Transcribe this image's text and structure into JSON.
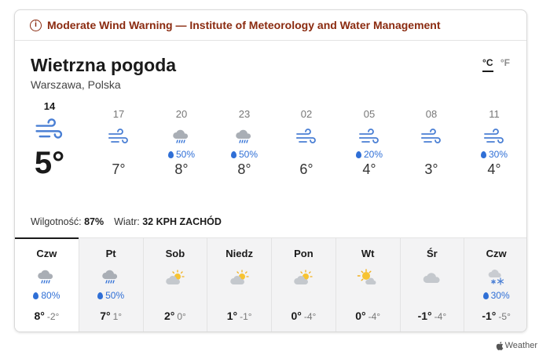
{
  "alert": {
    "icon": "info-circle-icon",
    "symbol": "i",
    "text": "Moderate Wind Warning — Institute of Meteorology and Water Management"
  },
  "header": {
    "title": "Wietrzna pogoda",
    "location": "Warszawa, Polska",
    "unit_c": "°C",
    "unit_f": "°F",
    "selected_unit": "C"
  },
  "hourly": [
    {
      "time": "14",
      "icon": "wind-icon",
      "precip": "",
      "temp": "5°",
      "current": true
    },
    {
      "time": "17",
      "icon": "wind-icon",
      "precip": "",
      "temp": "7°"
    },
    {
      "time": "20",
      "icon": "rain-icon",
      "precip": "50%",
      "temp": "8°"
    },
    {
      "time": "23",
      "icon": "rain-icon",
      "precip": "50%",
      "temp": "8°"
    },
    {
      "time": "02",
      "icon": "wind-icon",
      "precip": "",
      "temp": "6°"
    },
    {
      "time": "05",
      "icon": "wind-icon",
      "precip": "20%",
      "temp": "4°"
    },
    {
      "time": "08",
      "icon": "wind-icon",
      "precip": "",
      "temp": "3°"
    },
    {
      "time": "11",
      "icon": "wind-icon",
      "precip": "30%",
      "temp": "4°"
    }
  ],
  "details": {
    "humidity_label": "Wilgotność:",
    "humidity_value": "87%",
    "wind_label": "Wiatr:",
    "wind_value": "32 KPH ZACHÓD"
  },
  "daily": [
    {
      "day": "Czw",
      "icon": "rain-icon",
      "precip": "80%",
      "high": "8°",
      "low": "-2°",
      "selected": true
    },
    {
      "day": "Pt",
      "icon": "rain-icon",
      "precip": "50%",
      "high": "7°",
      "low": "1°"
    },
    {
      "day": "Sob",
      "icon": "partly-cloudy-icon",
      "precip": "",
      "high": "2°",
      "low": "0°"
    },
    {
      "day": "Niedz",
      "icon": "partly-cloudy-icon",
      "precip": "",
      "high": "1°",
      "low": "-1°"
    },
    {
      "day": "Pon",
      "icon": "partly-cloudy-icon",
      "precip": "",
      "high": "0°",
      "low": "-4°"
    },
    {
      "day": "Wt",
      "icon": "mostly-sunny-icon",
      "precip": "",
      "high": "0°",
      "low": "-4°"
    },
    {
      "day": "Śr",
      "icon": "cloudy-icon",
      "precip": "",
      "high": "-1°",
      "low": "-4°"
    },
    {
      "day": "Czw",
      "icon": "snow-icon",
      "precip": "30%",
      "high": "-1°",
      "low": "-5°"
    }
  ],
  "footer": {
    "brand": "Weather",
    "icon": "apple-logo-icon"
  },
  "colors": {
    "alert": "#8a2a0f",
    "precip": "#2f6fd6",
    "wind_icon": "#4a7fd4"
  }
}
